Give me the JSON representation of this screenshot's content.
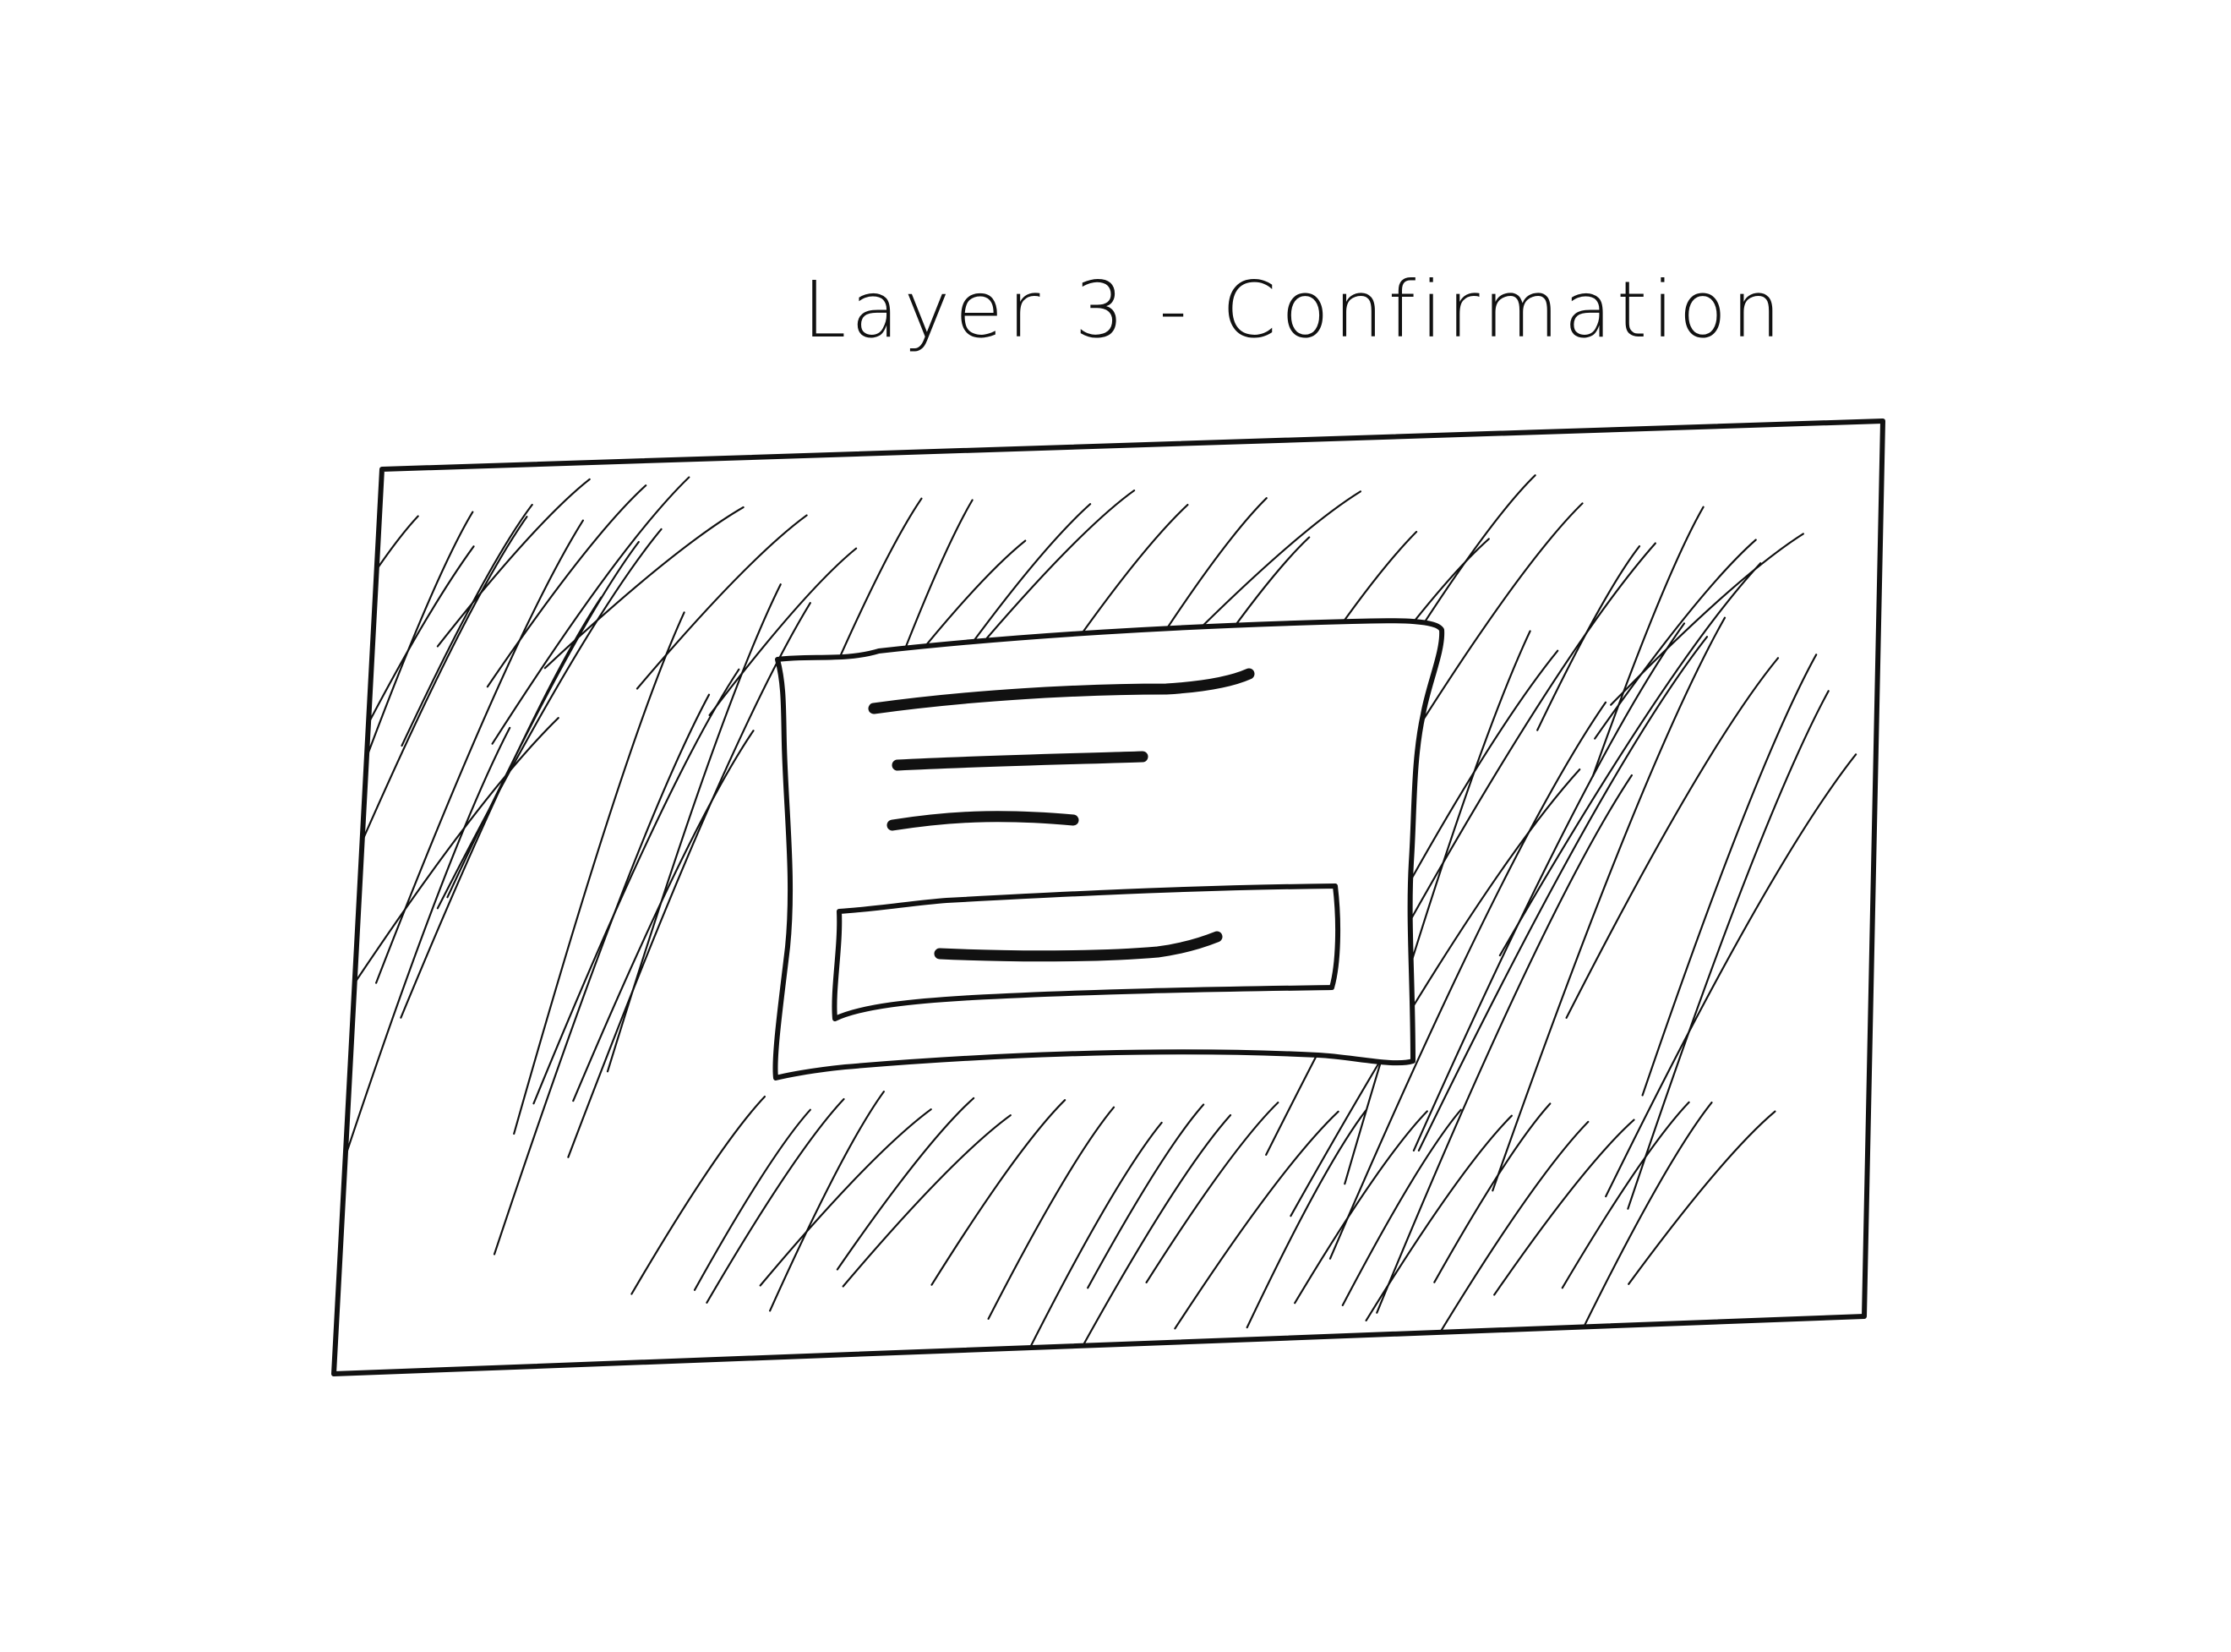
{
  "title": "Layer 3 - Confirmation",
  "colors": {
    "ink": "#111111",
    "paper": "#ffffff"
  },
  "diagram": {
    "overlay": {
      "style": "hatched",
      "meaning": "dimmed background"
    },
    "dialog": {
      "text_lines": 3,
      "has_button": true
    }
  }
}
